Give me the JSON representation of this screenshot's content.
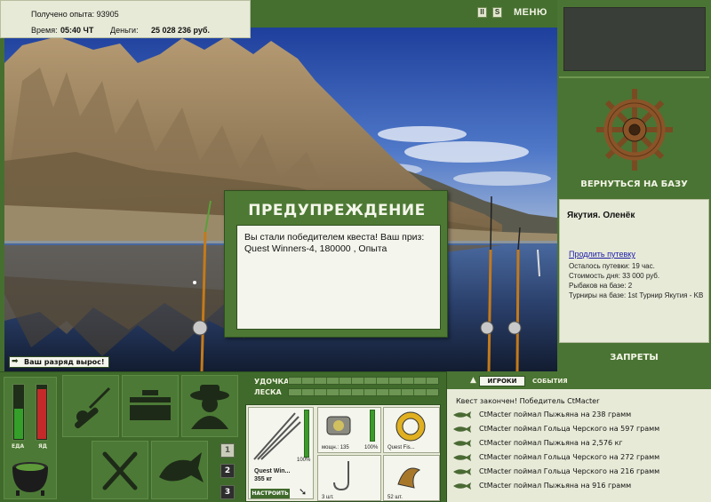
{
  "player": {
    "experience_label": "Получено опыта: 93905",
    "time_label": "Время:",
    "time_value": "05:40 ЧТ",
    "money_label": "Деньги:",
    "money_value": "25 028 236 руб."
  },
  "top_controls": {
    "pause_label": "II",
    "sound_label": "S",
    "menu_label": "МЕНЮ"
  },
  "right_panel": {
    "return_label": "ВЕРНУТЬСЯ НА БАЗУ",
    "location": "Якутия. Оленёк",
    "extend_link": "Продлить путевку",
    "lines": [
      "Осталось путевки: 19 час.",
      "Стоимость дня: 33 000 руб.",
      "Рыбаков на базе: 2",
      "Турниры на базе: 1st Турнир Якутия - KB"
    ],
    "bans_label": "ЗАПРЕТЫ"
  },
  "dialog": {
    "title": "ПРЕДУПРЕЖДЕНИЕ",
    "message": "Вы стали победителем квеста! Ваш приз: Quest Winners-4, 180000 , Опыта"
  },
  "rank_badge": "Ваш разряд вырос!",
  "status_meters": {
    "food_label": "ЕДА",
    "food_level": 0.55,
    "poison_label": "ЯД",
    "poison_level": 0.9
  },
  "inventory_tabs": [
    "1",
    "2",
    "3"
  ],
  "gear": {
    "rod_label": "УДОЧКА",
    "line_label": "ЛЕСКА",
    "rod_name": "Quest Win...",
    "rod_weight": "355 кг",
    "rod_condition": "100%",
    "configure_label": "НАСТРОИТЬ",
    "reel_power": "мощн.: 135",
    "reel_condition": "100%",
    "line_name": "Quest Fis...",
    "hooks_count": "3 шт.",
    "bait_count": "52 шт."
  },
  "events": {
    "tab_players": "ИГРОКИ",
    "tab_events": "СОБЫТИЯ",
    "first": "Квест закончен! Победитель CtMacter",
    "items": [
      "CtMacter поймал Пыжьяна на 238 грамм",
      "CtMacter поймал Гольца Черского на 597 грамм",
      "CtMacter поймал Пыжьяна на 2,576 кг",
      "CtMacter поймал Гольца Черского на 272 грамм",
      "CtMacter поймал Гольца Черского на 216 грамм",
      "CtMacter поймал Пыжьяна на 916 грамм"
    ]
  },
  "colors": {
    "panel_green": "#4a7433",
    "panel_light": "#e8ead8",
    "text_light": "#f2f4e6"
  }
}
